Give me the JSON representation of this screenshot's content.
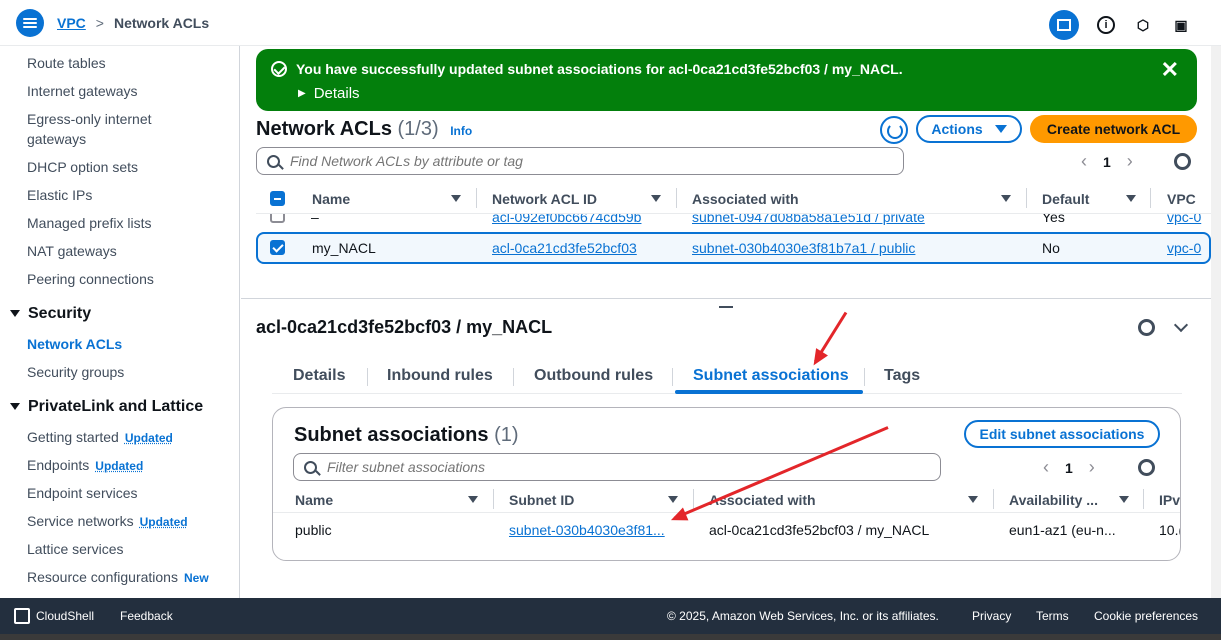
{
  "header": {
    "breadcrumb": [
      "VPC",
      "Network ACLs"
    ],
    "icons": [
      "menu-icon",
      "panel-icon",
      "info-icon",
      "settings-hex-icon",
      "feedback-icon"
    ]
  },
  "sidebar": {
    "items_top": [
      "Route tables",
      "Internet gateways",
      "Egress-only internet gateways",
      "DHCP option sets",
      "Elastic IPs",
      "Managed prefix lists",
      "NAT gateways",
      "Peering connections"
    ],
    "security": {
      "title": "Security",
      "items": [
        "Network ACLs",
        "Security groups"
      ]
    },
    "privatelink": {
      "title": "PrivateLink and Lattice",
      "items": [
        {
          "label": "Getting started",
          "badge": "Updated"
        },
        {
          "label": "Endpoints",
          "badge": "Updated"
        },
        {
          "label": "Endpoint services",
          "badge": ""
        },
        {
          "label": "Service networks",
          "badge": "Updated"
        },
        {
          "label": "Lattice services",
          "badge": ""
        },
        {
          "label": "Resource configurations",
          "badge": "New"
        }
      ]
    }
  },
  "flash": {
    "message": "You have successfully updated subnet associations for acl-0ca21cd3fe52bcf03 / my_NACL.",
    "details": "Details",
    "close": "✕",
    "color": "#037f0c"
  },
  "list": {
    "title": "Network ACLs",
    "count": "(1/3)",
    "info": "Info",
    "actions": "Actions",
    "create": "Create network ACL",
    "search_placeholder": "Find Network ACLs by attribute or tag",
    "page": "1",
    "columns": [
      "Name",
      "Network ACL ID",
      "Associated with",
      "Default",
      "VPC"
    ],
    "rows": [
      {
        "name": "–",
        "id": "acl-092ef0bc6674cd59b",
        "assoc": "subnet-0947d08ba58a1e51d / private",
        "default": "Yes",
        "vpc": "vpc-0",
        "selected": false
      },
      {
        "name": "my_NACL",
        "id": "acl-0ca21cd3fe52bcf03",
        "assoc": "subnet-030b4030e3f81b7a1 / public",
        "default": "No",
        "vpc": "vpc-0",
        "selected": true
      }
    ]
  },
  "detail": {
    "title": "acl-0ca21cd3fe52bcf03 / my_NACL",
    "tabs": [
      "Details",
      "Inbound rules",
      "Outbound rules",
      "Subnet associations",
      "Tags"
    ],
    "active_tab": "Subnet associations"
  },
  "subnet_panel": {
    "title": "Subnet associations",
    "count": "(1)",
    "edit_button": "Edit subnet associations",
    "search_placeholder": "Filter subnet associations",
    "page": "1",
    "columns": [
      "Name",
      "Subnet ID",
      "Associated with",
      "Availability ...",
      "IPv"
    ],
    "rows": [
      {
        "name": "public",
        "subnet_id": "subnet-030b4030e3f81...",
        "assoc": "acl-0ca21cd3fe52bcf03 / my_NACL",
        "az": "eun1-az1 (eu-n...",
        "ipv4": "10.("
      }
    ]
  },
  "footer": {
    "cloudshell": "CloudShell",
    "feedback": "Feedback",
    "copyright": "© 2025, Amazon Web Services, Inc. or its affiliates.",
    "privacy": "Privacy",
    "terms": "Terms",
    "cookies": "Cookie preferences"
  },
  "colors": {
    "accent": "#0972d3",
    "primary_button": "#ff9900",
    "annotation_arrow": "#e3262a",
    "footer": "#232f3e"
  }
}
